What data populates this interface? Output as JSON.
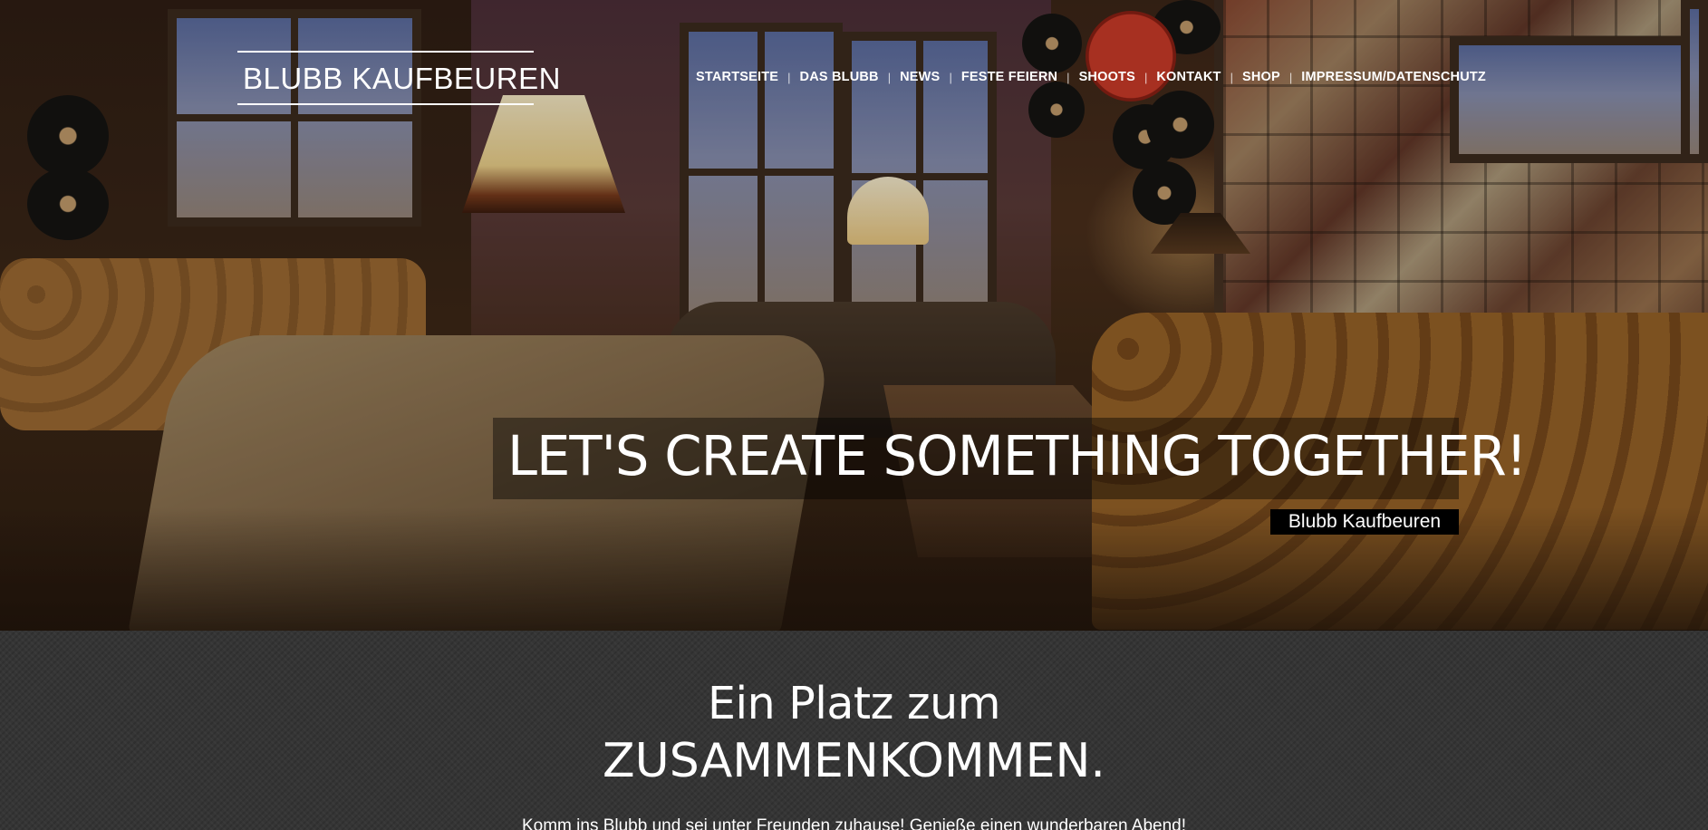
{
  "header": {
    "logo_text": "BLUBB KAUFBEUREN"
  },
  "nav": {
    "items": [
      {
        "label": "STARTSEITE",
        "active": true
      },
      {
        "label": "DAS BLUBB",
        "active": false
      },
      {
        "label": "NEWS",
        "active": false
      },
      {
        "label": "FESTE FEIERN",
        "active": false
      },
      {
        "label": "SHOOTS",
        "active": false
      },
      {
        "label": "KONTAKT",
        "active": false
      },
      {
        "label": "SHOP",
        "active": false
      },
      {
        "label": "IMPRESSUM/DATENSCHUTZ",
        "active": false
      }
    ],
    "separator": "|"
  },
  "hero": {
    "headline": "LET'S CREATE SOMETHING TOGETHER!",
    "subtitle": "Blubb Kaufbeuren"
  },
  "section": {
    "title_line1": "Ein Platz zum",
    "title_line2": "ZUSAMMENKOMMEN.",
    "text": "Komm ins Blubb und sei unter Freunden zuhause! Genieße einen wunderbaren Abend!"
  },
  "colors": {
    "text": "#ffffff",
    "section_bg": "#353535",
    "badge_bg": "#000000"
  }
}
